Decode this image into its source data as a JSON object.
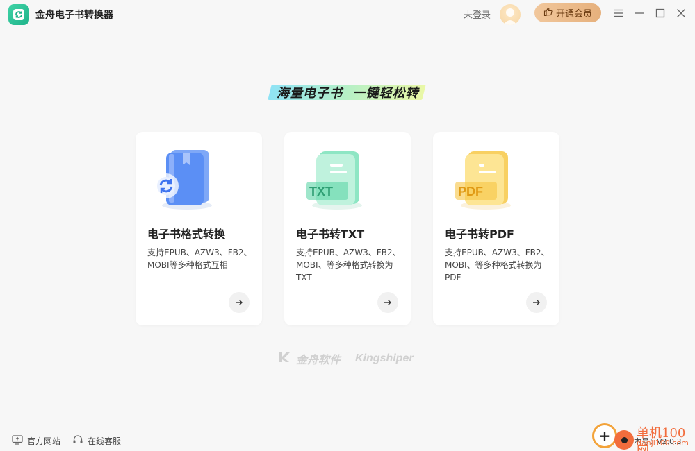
{
  "app": {
    "title": "金舟电子书转换器"
  },
  "header": {
    "login_text": "未登录",
    "vip_label": "开通会员",
    "vip_icon": "thumbs-up-icon",
    "window_controls": [
      "menu-icon",
      "minimize-icon",
      "maximize-icon",
      "close-icon"
    ]
  },
  "main": {
    "slogan": "海量电子书  一键轻松转",
    "cards": [
      {
        "title": "电子书格式转换",
        "desc": "支持EPUB、AZW3、FB2、MOBI等多种格式互相",
        "icon": "book-convert-icon",
        "color": "#5b8ff5"
      },
      {
        "title": "电子书转TXT",
        "desc": "支持EPUB、AZW3、FB2、MOBI、等多种格式转换为TXT",
        "icon": "txt-file-icon",
        "icon_label": "TXT",
        "color": "#5fd6a8"
      },
      {
        "title": "电子书转PDF",
        "desc": "支持EPUB、AZW3、FB2、MOBI、等多种格式转换为PDF",
        "icon": "pdf-file-icon",
        "icon_label": "PDF",
        "color": "#f7c544"
      }
    ]
  },
  "brand": {
    "cn": "金舟软件",
    "en": "Kingshiper"
  },
  "footer": {
    "website_label": "官方网站",
    "support_label": "在线客服",
    "version": "本号：V2.0.3"
  },
  "watermark": {
    "line1": "单机100网",
    "line2": "danji100.com"
  }
}
